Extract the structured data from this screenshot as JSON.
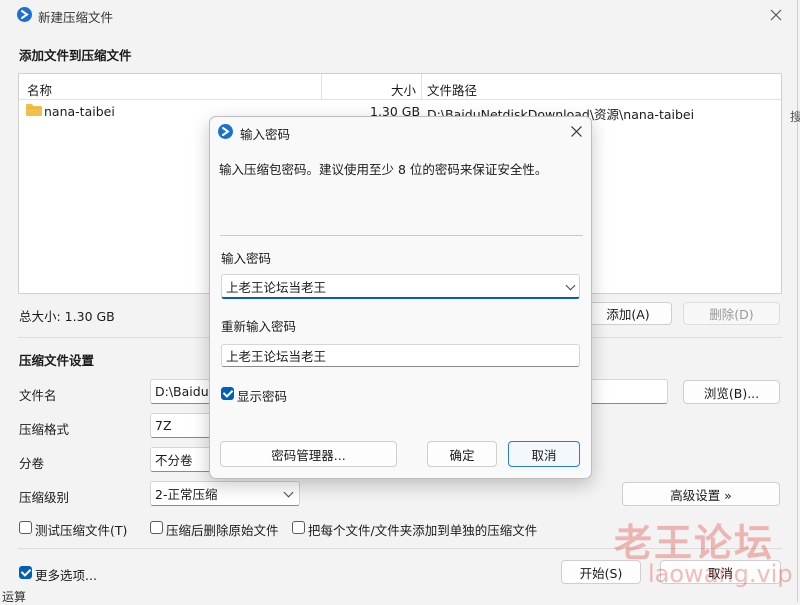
{
  "main": {
    "title": "新建压缩文件",
    "section_add": "添加文件到压缩文件",
    "columns": {
      "name": "名称",
      "size": "大小",
      "path": "文件路径"
    },
    "files": [
      {
        "name": "nana-taibei",
        "size": "1.30 GB",
        "path": "D:\\BaiduNetdiskDownload\\资源\\nana-taibei"
      }
    ],
    "total_size": "总大小: 1.30 GB",
    "add_button": "添加(A)",
    "delete_button": "删除(D)",
    "section_settings": "压缩文件设置",
    "filename_label": "文件名",
    "filename_value": "D:\\BaiduN",
    "browse_button": "浏览(B)...",
    "format_label": "压缩格式",
    "format_value": "7Z",
    "split_label": "分卷",
    "split_value": "不分卷",
    "level_label": "压缩级别",
    "level_value": "2-正常压缩",
    "advanced_button": "高级设置 »",
    "opt_test": "测试压缩文件(T)",
    "opt_delete_source": "压缩后删除原始文件",
    "opt_each_separately": "把每个文件/文件夹添加到单独的压缩文件",
    "more_options": "更多选项...",
    "start_button": "开始(S)",
    "cancel_button": "取消",
    "bg_text_right": "搜",
    "bg_text_bottom": "运算"
  },
  "dialog": {
    "title": "输入密码",
    "description": "输入压缩包密码。建议使用至少 8 位的密码来保证安全性。",
    "password_label": "输入密码",
    "password_value": "上老王论坛当老王",
    "reenter_label": "重新输入密码",
    "reenter_value": "上老王论坛当老王",
    "show_password": "显示密码",
    "manager_button": "密码管理器...",
    "ok_button": "确定",
    "cancel_button": "取消"
  },
  "watermark": {
    "text": "老王论坛",
    "url": "laowang.vip",
    "color": "#e0342a"
  },
  "colors": {
    "accent": "#005fb8",
    "folder": "#f2c04a"
  }
}
